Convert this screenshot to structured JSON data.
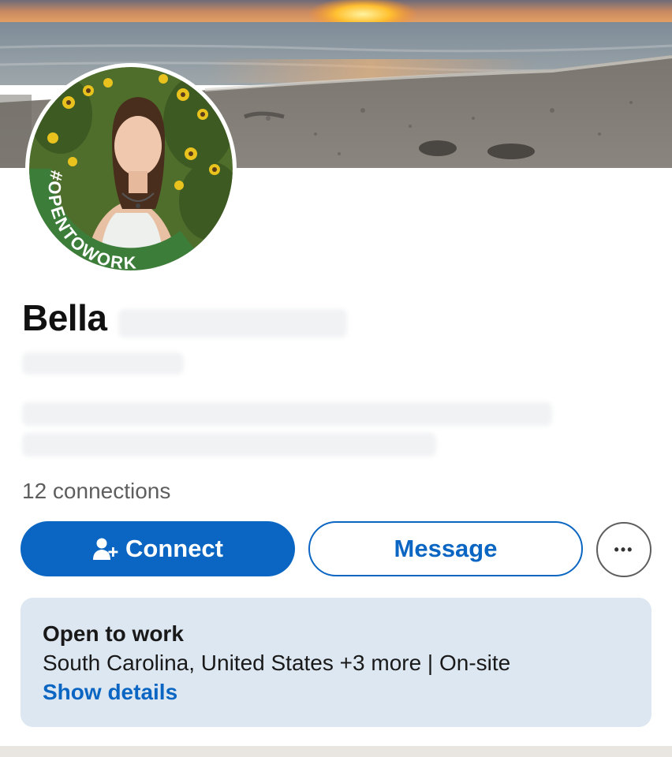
{
  "profile": {
    "first_name": "Bella",
    "badge_text": "#OPENTOWORK",
    "connections": "12 connections"
  },
  "actions": {
    "connect_label": "Connect",
    "message_label": "Message",
    "more_label": "•••"
  },
  "open_to_work": {
    "title": "Open to work",
    "detail": "South Carolina, United States +3 more | On-site",
    "link": "Show details"
  },
  "colors": {
    "brand_blue": "#0a66c2",
    "badge_green": "#3d7d3a",
    "card_bg": "#dde7f1"
  },
  "icons": {
    "connect": "add-person-icon",
    "more": "ellipsis-icon"
  }
}
